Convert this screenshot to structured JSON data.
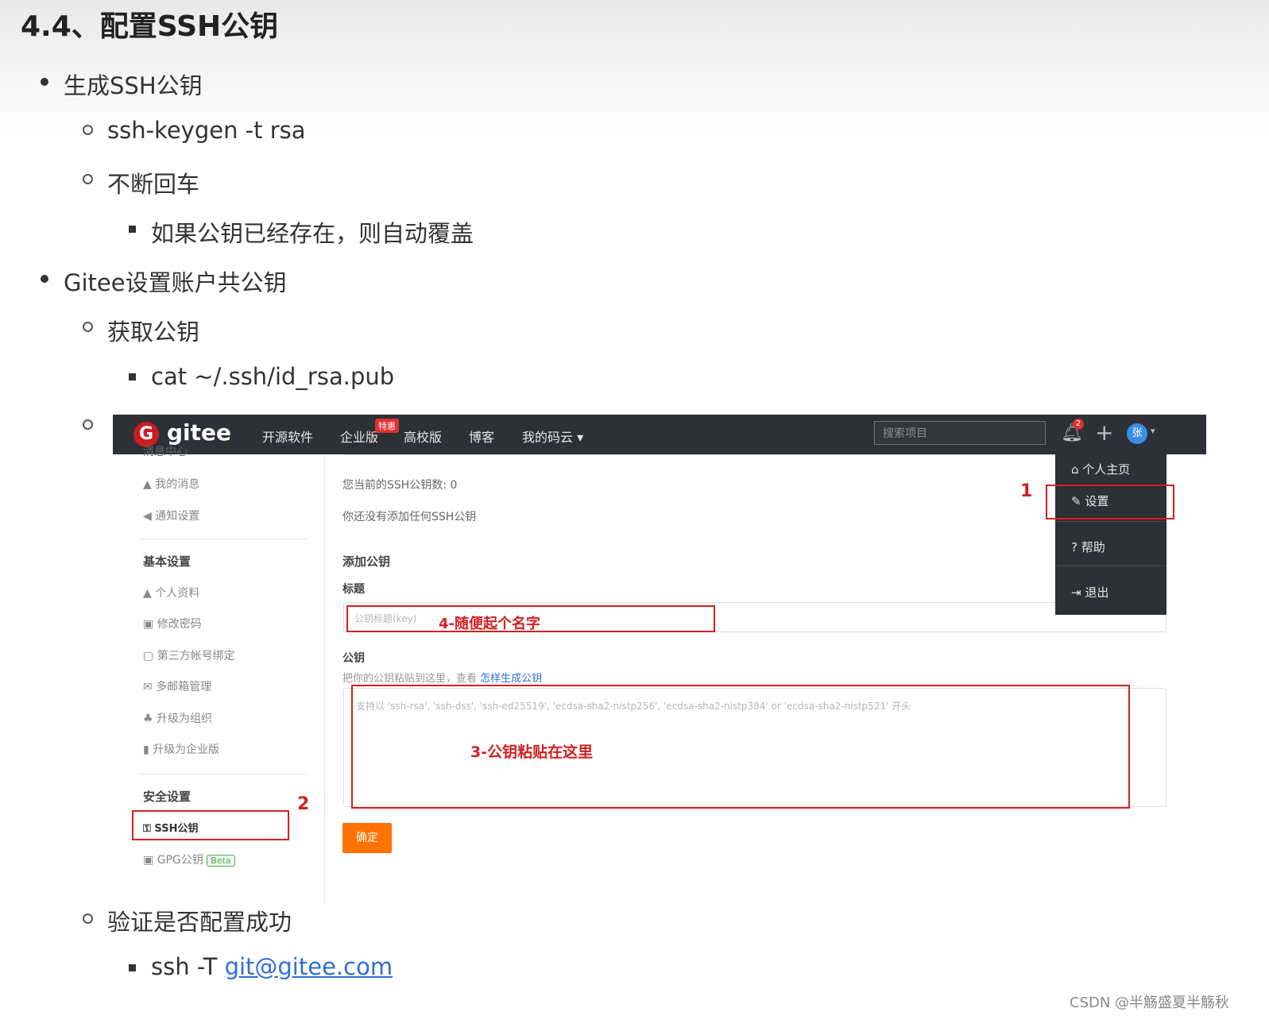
{
  "doc": {
    "heading": "4.4、配置SSH公钥",
    "items": {
      "gen": "生成SSH公钥",
      "keygen": "ssh-keygen -t rsa",
      "enter": "不断回车",
      "overwrite": "如果公钥已经存在，则自动覆盖",
      "gitee_setup": "Gitee设置账户共公钥",
      "get_key": "获取公钥",
      "cat_cmd": "cat ~/.ssh/id_rsa.pub",
      "verify": "验证是否配置成功",
      "ssh_cmd": "ssh -T ",
      "ssh_link": "git@gitee.com"
    }
  },
  "gitee": {
    "logo": "gitee",
    "nav": [
      "开源软件",
      "企业版",
      "高校版",
      "博客",
      "我的码云 ▾"
    ],
    "hot_badge": "特惠",
    "search_placeholder": "搜索项目",
    "notif_count": "2",
    "avatar_letter": "张",
    "sidebar": {
      "msg_center": "消息中心",
      "my_msgs": "我的消息",
      "notify_settings": "通知设置",
      "basic": "基本设置",
      "profile": "个人资料",
      "password": "修改密码",
      "third_party": "第三方帐号绑定",
      "email": "多邮箱管理",
      "upgrade_org": "升级为组织",
      "upgrade_ent": "升级为企业版",
      "security": "安全设置",
      "ssh": "SSH公钥",
      "gpg": "GPG公钥",
      "beta": "Beta"
    },
    "main": {
      "count_text": "您当前的SSH公钥数: 0",
      "none_text": "你还没有添加任何SSH公钥",
      "add_title": "添加公钥",
      "title_label": "标题",
      "title_placeholder": "公钥标题(key)",
      "key_label": "公钥",
      "key_hint": "把你的公钥粘贴到这里，查看 ",
      "key_hint_link": "怎样生成公钥",
      "key_placeholder": "支持以 'ssh-rsa', 'ssh-dss', 'ssh-ed25519', 'ecdsa-sha2-nistp256', 'ecdsa-sha2-nistp384' or 'ecdsa-sha2-nistp521' 开头",
      "ok_button": "确定"
    },
    "dropdown": [
      "个人主页",
      "设置",
      "帮助",
      "退出"
    ],
    "annotations": {
      "one": "1",
      "two": "2",
      "three": "3-公钥粘贴在这里",
      "four": "4-随便起个名字"
    }
  },
  "watermark": "CSDN @半觞盛夏半觞秋"
}
